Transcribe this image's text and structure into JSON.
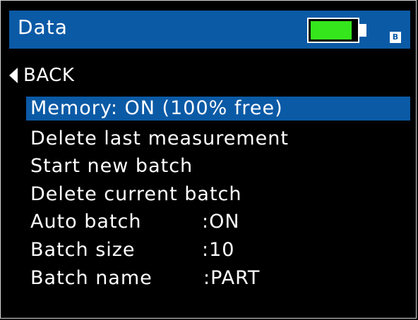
{
  "header": {
    "title": "Data",
    "battery": {
      "level": 0.9,
      "fill_color": "#35e61d",
      "icon": "battery-icon"
    },
    "badge": "B",
    "bar_color": "#0b5aa6"
  },
  "back": {
    "label": "BACK",
    "icon": "triangle-left-icon"
  },
  "menu": {
    "items": [
      {
        "label": "Memory: ON (100% free)",
        "value": "",
        "selected": true
      },
      {
        "label": "Delete last measurement",
        "value": ""
      },
      {
        "label": "Start new batch",
        "value": ""
      },
      {
        "label": "Delete current batch",
        "value": ""
      },
      {
        "label": "Auto batch",
        "value": ":ON"
      },
      {
        "label": "Batch size",
        "value": ":10"
      },
      {
        "label": "Batch name",
        "value": ":PART"
      }
    ]
  }
}
